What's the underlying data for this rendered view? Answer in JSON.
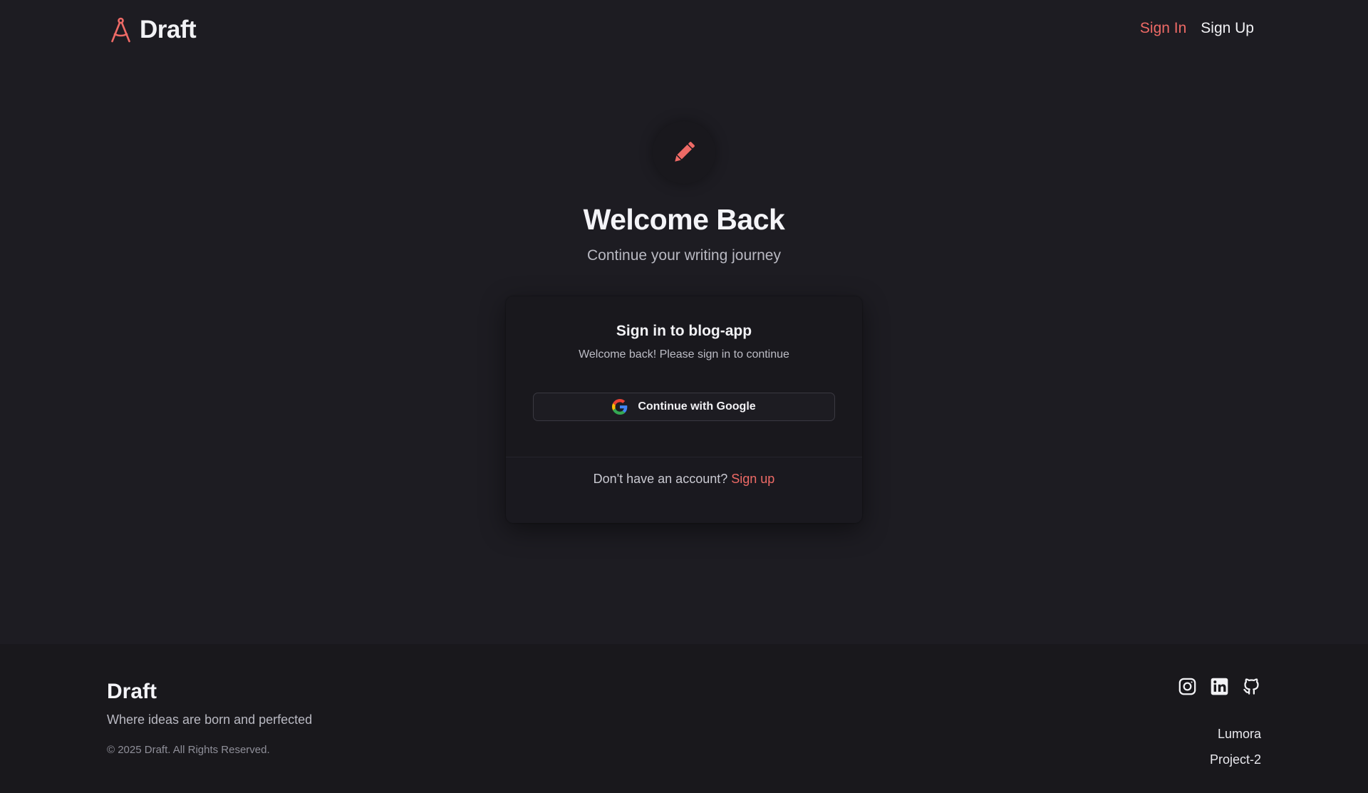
{
  "header": {
    "brand_name": "Draft",
    "brand_icon": "compass-drafting-icon",
    "nav": {
      "sign_in_label": "Sign In",
      "sign_up_label": "Sign Up"
    }
  },
  "hero": {
    "icon": "pencil-icon",
    "title": "Welcome Back",
    "subtitle": "Continue your writing journey"
  },
  "auth_card": {
    "title": "Sign in to blog-app",
    "subtitle": "Welcome back! Please sign in to continue",
    "google_button": {
      "icon": "google-icon",
      "label": "Continue with Google"
    },
    "footer_text": "Don't have an account?",
    "footer_link_label": "Sign up"
  },
  "footer": {
    "brand_name": "Draft",
    "tagline": "Where ideas are born and perfected",
    "copyright": "© 2025 Draft. All Rights Reserved.",
    "social_icons": [
      "instagram-icon",
      "linkedin-icon",
      "github-icon"
    ],
    "links": [
      "Lumora",
      "Project-2"
    ]
  },
  "colors": {
    "background": "#1d1c22",
    "accent": "#ee6a66",
    "card_background": "#19181d",
    "footer_background": "#19181c",
    "text_primary": "#f2f2f5",
    "text_secondary": "#b9b9c2"
  }
}
